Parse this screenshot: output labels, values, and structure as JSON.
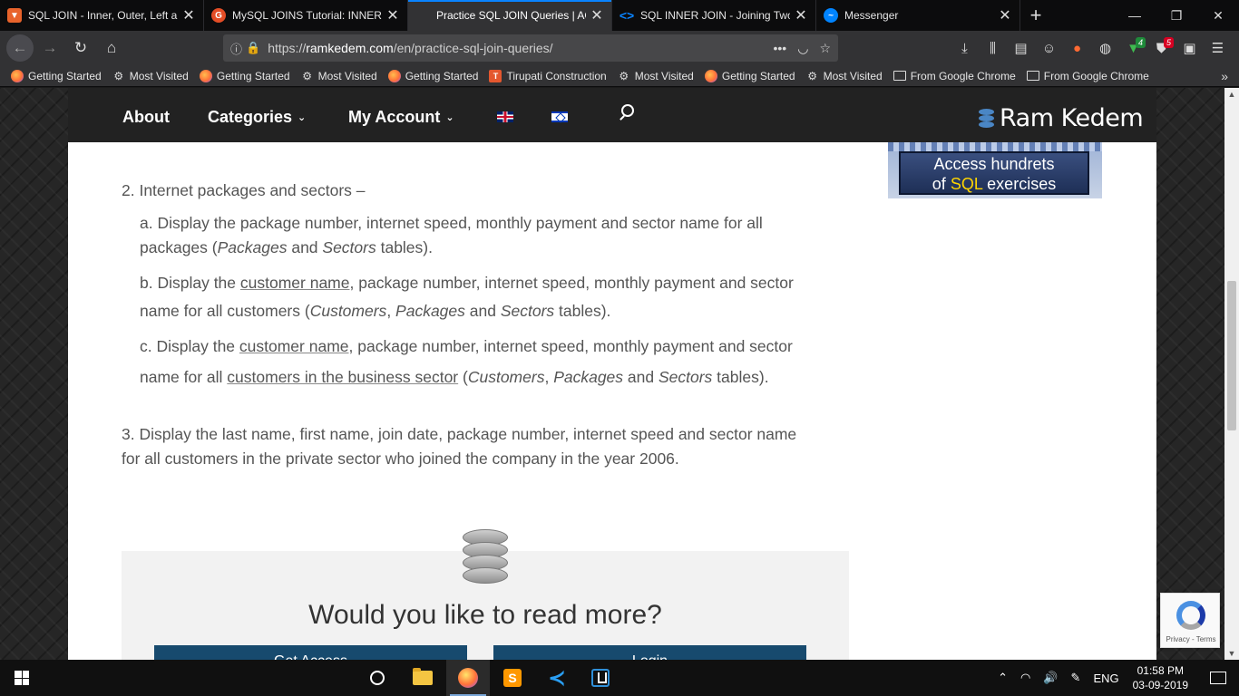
{
  "browser": {
    "tabs": [
      {
        "title": "SQL JOIN - Inner, Outer, Left an",
        "icon": "sql-tab-icon",
        "color": "#e8632b",
        "active": false
      },
      {
        "title": "MySQL JOINS Tutorial: INNER, (",
        "icon": "g-tab-icon",
        "color": "#e44d26",
        "active": false
      },
      {
        "title": "Practice SQL JOIN Queries | ACI",
        "icon": "page-tab-icon",
        "color": "#323234",
        "active": true
      },
      {
        "title": "SQL INNER JOIN - Joining Two",
        "icon": "code-tab-icon",
        "color": "#0a84ff",
        "active": false
      },
      {
        "title": "Messenger",
        "icon": "messenger-tab-icon",
        "color": "#0084ff",
        "active": false
      }
    ],
    "url": "https://ramkedem.com/en/practice-sql-join-queries/",
    "url_domain": "ramkedem.com",
    "url_prefix": "https://",
    "url_path": "/en/practice-sql-join-queries/",
    "toolbar_badges": {
      "ext1": "4",
      "ext2": "5"
    },
    "bookmarks": [
      {
        "label": "Getting Started",
        "icon": "firefox-icon"
      },
      {
        "label": "Most Visited",
        "icon": "gear-icon"
      },
      {
        "label": "Getting Started",
        "icon": "firefox-icon"
      },
      {
        "label": "Most Visited",
        "icon": "gear-icon"
      },
      {
        "label": "Getting Started",
        "icon": "firefox-icon"
      },
      {
        "label": "Tirupati Construction",
        "icon": "tc-icon"
      },
      {
        "label": "Most Visited",
        "icon": "gear-icon"
      },
      {
        "label": "Getting Started",
        "icon": "firefox-icon"
      },
      {
        "label": "Most Visited",
        "icon": "gear-icon"
      },
      {
        "label": "From Google Chrome",
        "icon": "folder-icon"
      },
      {
        "label": "From Google Chrome",
        "icon": "folder-icon"
      }
    ]
  },
  "site": {
    "nav": {
      "about": "About",
      "categories": "Categories",
      "my_account": "My Account",
      "chevron": "⌄"
    },
    "logo": "Ram Kedem",
    "banner": {
      "line1": "Access hundrets",
      "line2_pre": "of ",
      "line2_hl": "SQL",
      "line2_post": " exercises"
    },
    "content": {
      "q2": "2. Internet packages and sectors –",
      "q2a_1": "a. Display the package number, internet speed, monthly payment and sector name for all",
      "q2a_2_pre": "packages (",
      "q2a_2_t1": "Packages",
      "q2a_2_and": " and ",
      "q2a_2_t2": "Sectors",
      "q2a_2_post": " tables).",
      "q2b_1_pre": "b. Display the ",
      "q2b_1_link": "customer name",
      "q2b_1_post": ", package number, internet speed, monthly payment and sector",
      "q2b_2_pre": "name for all customers (",
      "q2b_2_t1": "Customers",
      "q2b_2_c": ", ",
      "q2b_2_t2": "Packages",
      "q2b_2_and": " and ",
      "q2b_2_t3": "Sectors",
      "q2b_2_post": " tables).",
      "q2c_1_pre": "c. Display the ",
      "q2c_1_link": "customer name",
      "q2c_1_post": ", package number, internet speed, monthly payment and sector",
      "q2c_2_pre": "name for all ",
      "q2c_2_link": "customers in the business sector",
      "q2c_2_open": " (",
      "q2c_2_t1": "Customers",
      "q2c_2_c": ", ",
      "q2c_2_t2": "Packages",
      "q2c_2_and": " and ",
      "q2c_2_t3": "Sectors",
      "q2c_2_post": " tables).",
      "q3_1": "3. Display the last name, first name, join date, package number, internet speed and sector name",
      "q3_2": "for all customers in the private sector who joined the company in the year 2006."
    },
    "more": {
      "title": "Would you like to read more?",
      "btn1": "Get Access",
      "btn2": "Login"
    },
    "recaptcha": "Privacy - Terms"
  },
  "taskbar": {
    "lang": "ENG",
    "time": "01:58 PM",
    "date": "03-09-2019"
  }
}
